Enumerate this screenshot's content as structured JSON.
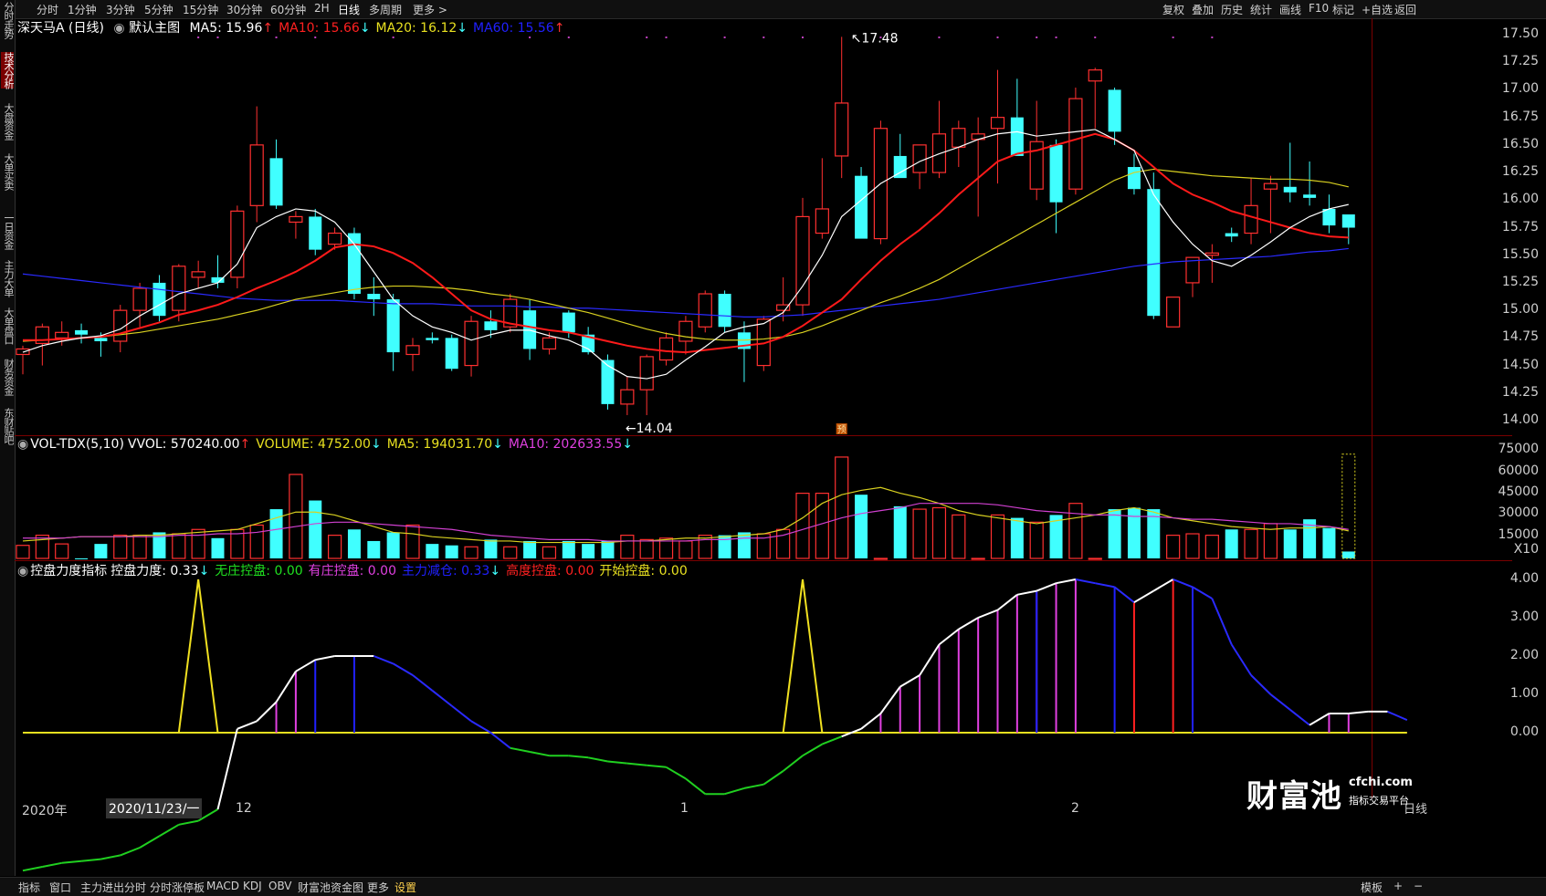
{
  "topbar": {
    "left_items": [
      "分时",
      "1分钟",
      "3分钟",
      "5分钟",
      "15分钟",
      "30分钟",
      "60分钟",
      "2H",
      "日线",
      "多周期",
      "更多 >"
    ],
    "active_left": "日线",
    "right_items": [
      "复权",
      "叠加",
      "历史",
      "统计",
      "画线",
      "F10",
      "标记",
      "+自选",
      "返回"
    ]
  },
  "sidebar": {
    "items": [
      "分时走势",
      "技术分析",
      "大盘资金",
      "大单买卖",
      "一日资金",
      "主力大单",
      "大单盘口",
      "财务资金",
      "东财贴吧"
    ],
    "active": "技术分析"
  },
  "main_panel": {
    "title": "深天马A",
    "period": "(日线)",
    "template": "默认主图",
    "ma_items": [
      {
        "label": "MA5: 15.96",
        "arrow": "↑",
        "color": "#ffffff"
      },
      {
        "label": "MA10: 15.66",
        "arrow": "↓",
        "color": "#ff2020"
      },
      {
        "label": "MA20: 16.12",
        "arrow": "↓",
        "color": "#e8e020"
      },
      {
        "label": "MA60: 15.56",
        "arrow": "↑",
        "color": "#2020ff"
      }
    ],
    "y_labels": [
      "17.50",
      "17.25",
      "17.00",
      "16.75",
      "16.50",
      "16.25",
      "16.00",
      "15.75",
      "15.50",
      "15.25",
      "15.00",
      "14.75",
      "14.50",
      "14.25",
      "14.00"
    ],
    "high_annotation": "17.48",
    "low_annotation": "14.04",
    "pre_marker": "预"
  },
  "volume_panel": {
    "title": "VOL-TDX(5,10)",
    "items": [
      {
        "label": "VVOL: 570240.00",
        "arrow": "↑",
        "color": "#ffffff"
      },
      {
        "label": "VOLUME: 4752.00",
        "arrow": "↓",
        "color": "#e8e020"
      },
      {
        "label": "MA5: 194031.70",
        "arrow": "↓",
        "color": "#e8e020"
      },
      {
        "label": "MA10: 202633.55",
        "arrow": "↓",
        "color": "#e040e0"
      }
    ],
    "y_labels": [
      "75000",
      "60000",
      "45000",
      "30000",
      "15000",
      "X10"
    ]
  },
  "indicator_panel": {
    "title": "控盘力度指标",
    "items": [
      {
        "label": "控盘力度: 0.33",
        "arrow": "↓",
        "color": "#ffffff"
      },
      {
        "label": "无庄控盘: 0.00",
        "arrow": "",
        "color": "#20e020"
      },
      {
        "label": "有庄控盘: 0.00",
        "arrow": "",
        "color": "#e040e0"
      },
      {
        "label": "主力减仓: 0.33",
        "arrow": "↓",
        "color": "#2020ff"
      },
      {
        "label": "高度控盘: 0.00",
        "arrow": "",
        "color": "#ff2020"
      },
      {
        "label": "开始控盘: 0.00",
        "arrow": "",
        "color": "#e8e020"
      }
    ],
    "y_labels": [
      "4.00",
      "3.00",
      "2.00",
      "1.00",
      "0.00"
    ]
  },
  "x_axis": {
    "labels": [
      "2020年",
      "12",
      "1",
      "2"
    ],
    "cursor_date": "2020/11/23/一"
  },
  "bottombar": {
    "items": [
      "指标",
      "窗口",
      "主力进出分时",
      "分时涨停板",
      "MACD",
      "KDJ",
      "OBV",
      "财富池资金图",
      "更多",
      "设置"
    ],
    "active": "设置",
    "right_items": [
      "模板",
      "+",
      "−"
    ]
  },
  "watermark": {
    "brand": "财富池",
    "domain": "cfchi.com",
    "tagline": "指标交易平台",
    "period_label": "日线"
  },
  "chart_data": {
    "type": "candlestick",
    "up_color": "#ff3030",
    "down_color": "#40ffff",
    "ylim": [
      14.0,
      17.5
    ],
    "candles": [
      [
        14.6,
        14.68,
        14.42,
        14.65
      ],
      [
        14.7,
        14.88,
        14.5,
        14.85
      ],
      [
        14.75,
        14.9,
        14.68,
        14.8
      ],
      [
        14.82,
        14.88,
        14.7,
        14.78
      ],
      [
        14.75,
        14.8,
        14.58,
        14.72
      ],
      [
        14.72,
        15.05,
        14.62,
        15.0
      ],
      [
        15.0,
        15.25,
        14.85,
        15.2
      ],
      [
        15.25,
        15.32,
        14.9,
        14.95
      ],
      [
        15.0,
        15.42,
        14.9,
        15.4
      ],
      [
        15.3,
        15.45,
        15.2,
        15.35
      ],
      [
        15.3,
        15.5,
        15.2,
        15.25
      ],
      [
        15.3,
        15.95,
        15.2,
        15.9
      ],
      [
        15.95,
        16.85,
        15.8,
        16.5
      ],
      [
        16.38,
        16.55,
        15.92,
        15.95
      ],
      [
        15.8,
        15.9,
        15.65,
        15.85
      ],
      [
        15.85,
        15.92,
        15.5,
        15.55
      ],
      [
        15.6,
        15.75,
        15.55,
        15.7
      ],
      [
        15.7,
        15.75,
        15.1,
        15.15
      ],
      [
        15.15,
        15.3,
        14.95,
        15.1
      ],
      [
        15.1,
        15.15,
        14.45,
        14.62
      ],
      [
        14.6,
        14.75,
        14.45,
        14.68
      ],
      [
        14.75,
        14.8,
        14.7,
        14.73
      ],
      [
        14.75,
        14.78,
        14.45,
        14.47
      ],
      [
        14.5,
        14.95,
        14.4,
        14.9
      ],
      [
        14.9,
        15.0,
        14.75,
        14.82
      ],
      [
        14.85,
        15.15,
        14.8,
        15.1
      ],
      [
        15.0,
        15.1,
        14.55,
        14.65
      ],
      [
        14.65,
        14.8,
        14.6,
        14.75
      ],
      [
        14.98,
        15.0,
        14.75,
        14.8
      ],
      [
        14.78,
        14.85,
        14.6,
        14.62
      ],
      [
        14.55,
        14.6,
        14.1,
        14.15
      ],
      [
        14.15,
        14.4,
        14.05,
        14.28
      ],
      [
        14.28,
        14.6,
        14.05,
        14.58
      ],
      [
        14.55,
        14.8,
        14.5,
        14.75
      ],
      [
        14.72,
        14.95,
        14.6,
        14.9
      ],
      [
        14.85,
        15.18,
        14.8,
        15.15
      ],
      [
        15.15,
        15.18,
        14.8,
        14.85
      ],
      [
        14.8,
        14.9,
        14.35,
        14.65
      ],
      [
        14.5,
        14.95,
        14.45,
        14.92
      ],
      [
        15.0,
        15.3,
        14.9,
        15.05
      ],
      [
        15.05,
        16.02,
        14.95,
        15.85
      ],
      [
        15.7,
        16.38,
        15.65,
        15.92
      ],
      [
        16.4,
        17.48,
        16.2,
        16.88
      ],
      [
        16.22,
        16.3,
        15.7,
        15.65
      ],
      [
        15.65,
        16.72,
        15.6,
        16.65
      ],
      [
        16.4,
        16.6,
        16.35,
        16.2
      ],
      [
        16.25,
        16.5,
        16.1,
        16.5
      ],
      [
        16.25,
        16.9,
        16.2,
        16.6
      ],
      [
        16.48,
        16.72,
        16.3,
        16.65
      ],
      [
        16.55,
        16.75,
        15.85,
        16.6
      ],
      [
        16.65,
        17.18,
        16.15,
        16.75
      ],
      [
        16.75,
        17.1,
        16.45,
        16.4
      ],
      [
        16.1,
        16.9,
        16.0,
        16.53
      ],
      [
        16.5,
        16.55,
        15.7,
        15.98
      ],
      [
        16.1,
        17.02,
        16.05,
        16.92
      ],
      [
        17.08,
        17.2,
        16.65,
        17.18
      ],
      [
        17.0,
        17.02,
        16.5,
        16.62
      ],
      [
        16.3,
        16.42,
        16.05,
        16.1
      ],
      [
        16.1,
        16.25,
        14.92,
        14.95
      ],
      [
        14.85,
        15.1,
        14.85,
        15.12
      ],
      [
        15.25,
        15.42,
        15.12,
        15.48
      ],
      [
        15.5,
        15.6,
        15.25,
        15.52
      ],
      [
        15.7,
        15.75,
        15.62,
        15.67
      ],
      [
        15.7,
        16.2,
        15.6,
        15.95
      ],
      [
        16.1,
        16.22,
        15.7,
        16.15
      ],
      [
        16.12,
        16.52,
        15.98,
        16.07
      ],
      [
        16.05,
        16.35,
        15.95,
        16.02
      ],
      [
        15.92,
        16.05,
        15.7,
        15.77
      ],
      [
        15.87,
        15.87,
        15.6,
        15.75
      ]
    ],
    "ma5": [
      14.62,
      14.68,
      14.72,
      14.75,
      14.77,
      14.83,
      14.95,
      15.05,
      15.15,
      15.2,
      15.25,
      15.42,
      15.75,
      15.85,
      15.92,
      15.9,
      15.8,
      15.6,
      15.35,
      15.1,
      14.95,
      14.85,
      14.8,
      14.73,
      14.78,
      14.82,
      14.82,
      14.77,
      14.73,
      14.65,
      14.5,
      14.4,
      14.38,
      14.42,
      14.55,
      14.67,
      14.8,
      14.85,
      14.88,
      14.98,
      15.22,
      15.5,
      15.85,
      16.0,
      16.15,
      16.25,
      16.35,
      16.42,
      16.48,
      16.55,
      16.6,
      16.62,
      16.58,
      16.6,
      16.62,
      16.64,
      16.55,
      16.45,
      16.05,
      15.8,
      15.6,
      15.45,
      15.4,
      15.5,
      15.62,
      15.75,
      15.85,
      15.92,
      15.96
    ],
    "ma10": [
      14.73,
      14.73,
      14.74,
      14.75,
      14.76,
      14.79,
      14.84,
      14.89,
      14.96,
      15.0,
      15.05,
      15.12,
      15.2,
      15.27,
      15.35,
      15.45,
      15.57,
      15.6,
      15.58,
      15.52,
      15.43,
      15.3,
      15.15,
      15.0,
      14.92,
      14.88,
      14.85,
      14.82,
      14.8,
      14.76,
      14.72,
      14.68,
      14.65,
      14.63,
      14.62,
      14.64,
      14.66,
      14.68,
      14.7,
      14.76,
      14.86,
      14.98,
      15.1,
      15.28,
      15.45,
      15.6,
      15.73,
      15.88,
      16.05,
      16.2,
      16.35,
      16.42,
      16.45,
      16.5,
      16.55,
      16.6,
      16.55,
      16.45,
      16.3,
      16.15,
      16.05,
      15.98,
      15.9,
      15.85,
      15.8,
      15.75,
      15.7,
      15.67,
      15.66
    ],
    "ma20": [
      14.72,
      14.73,
      14.74,
      14.75,
      14.76,
      14.78,
      14.8,
      14.83,
      14.86,
      14.89,
      14.92,
      14.96,
      15.0,
      15.05,
      15.1,
      15.13,
      15.16,
      15.19,
      15.21,
      15.22,
      15.22,
      15.21,
      15.2,
      15.18,
      15.15,
      15.13,
      15.1,
      15.06,
      15.02,
      14.98,
      14.93,
      14.88,
      14.83,
      14.79,
      14.76,
      14.74,
      14.73,
      14.73,
      14.74,
      14.76,
      14.8,
      14.86,
      14.93,
      15.0,
      15.07,
      15.13,
      15.2,
      15.28,
      15.38,
      15.48,
      15.58,
      15.68,
      15.78,
      15.88,
      15.98,
      16.08,
      16.18,
      16.25,
      16.28,
      16.26,
      16.24,
      16.22,
      16.21,
      16.2,
      16.19,
      16.19,
      16.18,
      16.16,
      16.12
    ],
    "ma60": [
      15.33,
      15.31,
      15.29,
      15.27,
      15.25,
      15.23,
      15.21,
      15.19,
      15.17,
      15.15,
      15.13,
      15.11,
      15.1,
      15.09,
      15.09,
      15.09,
      15.09,
      15.08,
      15.07,
      15.06,
      15.06,
      15.06,
      15.05,
      15.04,
      15.04,
      15.04,
      15.03,
      15.03,
      15.02,
      15.02,
      15.01,
      15.0,
      14.99,
      14.98,
      14.97,
      14.96,
      14.95,
      14.94,
      14.94,
      14.95,
      14.96,
      14.98,
      15.0,
      15.02,
      15.04,
      15.06,
      15.08,
      15.1,
      15.13,
      15.16,
      15.19,
      15.22,
      15.25,
      15.28,
      15.31,
      15.34,
      15.37,
      15.4,
      15.42,
      15.44,
      15.45,
      15.46,
      15.47,
      15.48,
      15.49,
      15.51,
      15.53,
      15.54,
      15.56
    ],
    "volume": [
      9000,
      16000,
      10000,
      0,
      10000,
      16000,
      16000,
      18000,
      17000,
      20000,
      14000,
      20000,
      23000,
      34000,
      58000,
      40000,
      16000,
      20000,
      12000,
      18000,
      23000,
      10000,
      9000,
      8000,
      13000,
      8000,
      12000,
      8000,
      12000,
      10000,
      12000,
      16000,
      13000,
      14000,
      12000,
      16000,
      16000,
      18000,
      17000,
      20000,
      45000,
      45000,
      70000,
      44000,
      0,
      36000,
      34000,
      35000,
      30000,
      0,
      30000,
      28000,
      25000,
      30000,
      38000,
      0,
      34000,
      35000,
      34000,
      16000,
      17000,
      16000,
      20000,
      20000,
      24000,
      20000,
      27000,
      21000,
      4752
    ],
    "vol_ma5": [
      12000,
      13000,
      14000,
      15000,
      15000,
      15000,
      16000,
      16000,
      17000,
      18000,
      19000,
      20000,
      24000,
      28000,
      32000,
      32000,
      30000,
      26000,
      22000,
      18000,
      17000,
      15000,
      14000,
      13000,
      12000,
      12000,
      11000,
      11000,
      11000,
      11000,
      11000,
      12000,
      12000,
      13000,
      14000,
      14000,
      15000,
      16000,
      17000,
      20000,
      28000,
      38000,
      44000,
      47000,
      49000,
      45000,
      42000,
      38000,
      33000,
      30000,
      28000,
      26000,
      24000,
      26000,
      28000,
      30000,
      33000,
      35000,
      32000,
      28000,
      26000,
      24000,
      22000,
      21000,
      20000,
      21000,
      21000,
      22000,
      19000
    ],
    "vol_ma10": [
      14000,
      14000,
      14000,
      15000,
      15000,
      15000,
      15000,
      15000,
      16000,
      16000,
      17000,
      17000,
      18000,
      20000,
      22000,
      24000,
      25000,
      25000,
      24000,
      23000,
      22000,
      21000,
      20000,
      18000,
      16000,
      15000,
      14000,
      13000,
      13000,
      13000,
      12000,
      12000,
      12000,
      12000,
      12000,
      13000,
      13000,
      14000,
      14000,
      16000,
      20000,
      24000,
      28000,
      31000,
      33000,
      35000,
      38000,
      38000,
      38000,
      38000,
      37000,
      35000,
      33000,
      32000,
      31000,
      30000,
      30000,
      29000,
      29000,
      28000,
      27000,
      27000,
      26000,
      25000,
      24000,
      24000,
      23000,
      22000,
      20000
    ],
    "kongpan": [
      -3.6,
      -3.5,
      -3.4,
      -3.35,
      -3.3,
      -3.2,
      -3.0,
      -2.7,
      -2.4,
      -2.3,
      -2.0,
      0.1,
      0.3,
      0.8,
      1.6,
      1.9,
      2.0,
      2.0,
      2.0,
      1.8,
      1.5,
      1.1,
      0.7,
      0.3,
      0.0,
      -0.4,
      -0.5,
      -0.6,
      -0.6,
      -0.65,
      -0.75,
      -0.8,
      -0.85,
      -0.9,
      -1.2,
      -1.6,
      -1.6,
      -1.45,
      -1.35,
      -1.0,
      -0.6,
      -0.3,
      -0.1,
      0.1,
      0.5,
      1.2,
      1.5,
      2.3,
      2.7,
      3.0,
      3.2,
      3.6,
      3.7,
      3.9,
      4.0,
      3.9,
      3.8,
      3.4,
      3.7,
      4.0,
      3.8,
      3.5,
      2.3,
      1.5,
      1.0,
      0.6,
      0.2,
      0.5,
      0.5,
      0.55,
      0.55,
      0.33
    ]
  }
}
